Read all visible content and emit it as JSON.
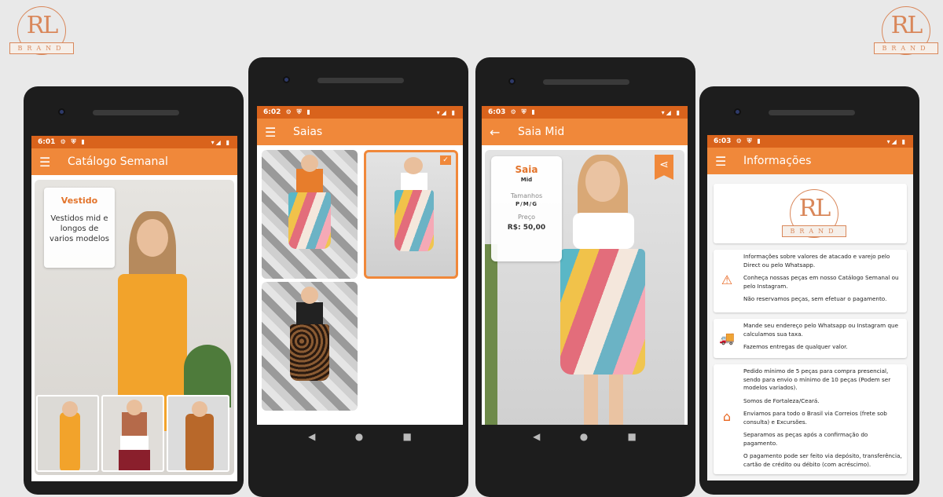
{
  "logo": {
    "mark": "RL",
    "word": "BRAND"
  },
  "phones": [
    {
      "time": "6:01",
      "status_icons": "⚙ ⛨ ▮",
      "right_icons": "▾◢ ▮",
      "title": "Catálogo Semanal",
      "nav_icon": "menu-icon"
    },
    {
      "time": "6:02",
      "status_icons": "⚙ ⛨ ▮",
      "right_icons": "▾◢ ▮",
      "title": "Saias",
      "nav_icon": "menu-icon"
    },
    {
      "time": "6:03",
      "status_icons": "⚙ ⛨ ▮",
      "right_icons": "▾◢ ▮",
      "title": "Saia Mid",
      "nav_icon": "back-arrow-icon"
    },
    {
      "time": "6:03",
      "status_icons": "⚙ ⛨ ▮",
      "right_icons": "▾◢ ▮",
      "title": "Informações",
      "nav_icon": "menu-icon"
    }
  ],
  "catalog": {
    "card_title": "Vestido",
    "card_desc": "Vestidos mid e longos de varios modelos"
  },
  "product": {
    "name": "Saia",
    "subtitle": "Mid",
    "sizes_label": "Tamanhos",
    "sizes": "P/M/G",
    "price_label": "Preço",
    "price": "R$: 50,00"
  },
  "info": {
    "boxes": [
      {
        "icon": "warning-icon",
        "lines": [
          "Informações sobre valores de atacado e varejo pelo Direct ou pelo Whatsapp.",
          "Conheça nossas peças em nosso Catálogo Semanal ou pelo Instagram.",
          "Não reservamos peças, sem efetuar o pagamento."
        ]
      },
      {
        "icon": "delivery-truck-icon",
        "lines": [
          "Mande seu endereço pelo Whatsapp ou Instagram que calculamos sua taxa.",
          "Fazemos entregas de qualquer valor."
        ]
      },
      {
        "icon": "store-icon",
        "lines": [
          "Pedido mínimo de 5 peças para compra presencial, sendo para envio o mínimo de 10 peças (Podem ser modelos variados).",
          "Somos de Fortaleza/Ceará.",
          "Enviamos para todo o Brasil via Correios (frete sob consulta) e Excursões.",
          "Separamos as peças após a confirmação do pagamento.",
          "O pagamento pode ser feito via depósito, transferência, cartão de crédito ou débito (com acréscimo)."
        ]
      }
    ]
  },
  "colors": {
    "primary": "#f0883a",
    "status": "#d9631c",
    "accent": "#e3742b"
  }
}
